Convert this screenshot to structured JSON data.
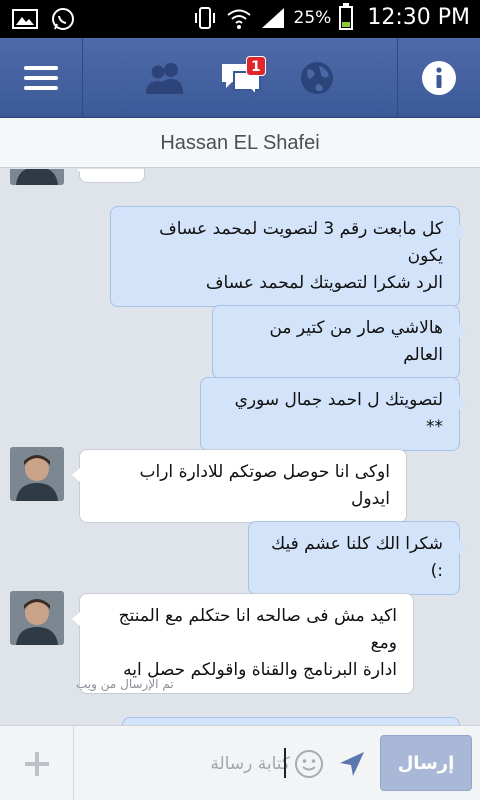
{
  "status_bar": {
    "battery_percent": "25%",
    "time": "12:30 PM",
    "icons": [
      "gallery-icon",
      "whatsapp-icon",
      "vibrate-icon",
      "wifi-icon",
      "signal-icon",
      "battery-icon"
    ],
    "battery_level": 0.25
  },
  "nav": {
    "icons": [
      "menu-icon",
      "friend-requests-icon",
      "messages-icon",
      "notifications-globe-icon",
      "info-icon"
    ],
    "messages_badge": "1",
    "colors": {
      "bar": "#3b5998",
      "badge": "#e0262b"
    }
  },
  "conversation": {
    "title": "Hassan EL Shafei",
    "messages": [
      {
        "direction": "out",
        "lines": [
          "كل مابعت رقم 3 لتصويت لمحمد عساف يكون",
          "الرد شكرا لتصويتك لمحمد عساف"
        ]
      },
      {
        "direction": "out",
        "lines": [
          "هالاشي صار من كتير من العالم"
        ]
      },
      {
        "direction": "out",
        "lines": [
          "لتصويتك ل احمد جمال سوري **"
        ]
      },
      {
        "direction": "in",
        "lines": [
          "اوكى انا  حوصل صوتكم للادارة اراب ايدول"
        ]
      },
      {
        "direction": "out",
        "lines": [
          "شكرا الك كلنا عشم فيك :)"
        ]
      },
      {
        "direction": "in",
        "lines": [
          "اكيد مش فى صالحه انا حتكلم مع المنتج ومع",
          "ادارة البرنامج والقناة واقولكم حصل ايه"
        ]
      }
    ],
    "sent_from_web": "تم الإرسال من ويب"
  },
  "composer": {
    "placeholder": "كتابة رسالة",
    "value": "",
    "send_label": "إرسال",
    "icons": [
      "add-icon",
      "emoji-icon",
      "location-icon"
    ]
  }
}
